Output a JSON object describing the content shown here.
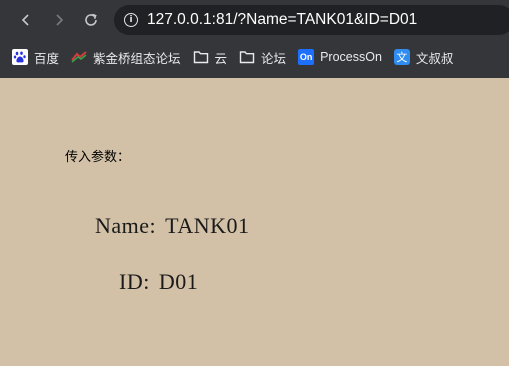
{
  "browser": {
    "url_host": "127.0.0.1",
    "url_rest": ":81/?Name=TANK01&ID=D01",
    "bookmarks": [
      {
        "label": "百度",
        "icon": "baidu-icon"
      },
      {
        "label": "紫金桥组态论坛",
        "icon": "forum-favicon"
      },
      {
        "label": "云",
        "icon": "folder-icon"
      },
      {
        "label": "论坛",
        "icon": "folder-icon"
      },
      {
        "label": "ProcessOn",
        "icon": "processon-icon"
      },
      {
        "label": "文叔叔",
        "icon": "wenshushu-icon"
      }
    ],
    "processon_badge": "On",
    "wenshushu_badge": "文"
  },
  "page": {
    "params_label": "传入参数：",
    "name_key": "Name:",
    "name_value": "TANK01",
    "id_key": "ID:",
    "id_value": "D01"
  },
  "colors": {
    "page_background": "#d2c1a7",
    "chrome_background": "#35363a",
    "omnibox_background": "#202124"
  }
}
